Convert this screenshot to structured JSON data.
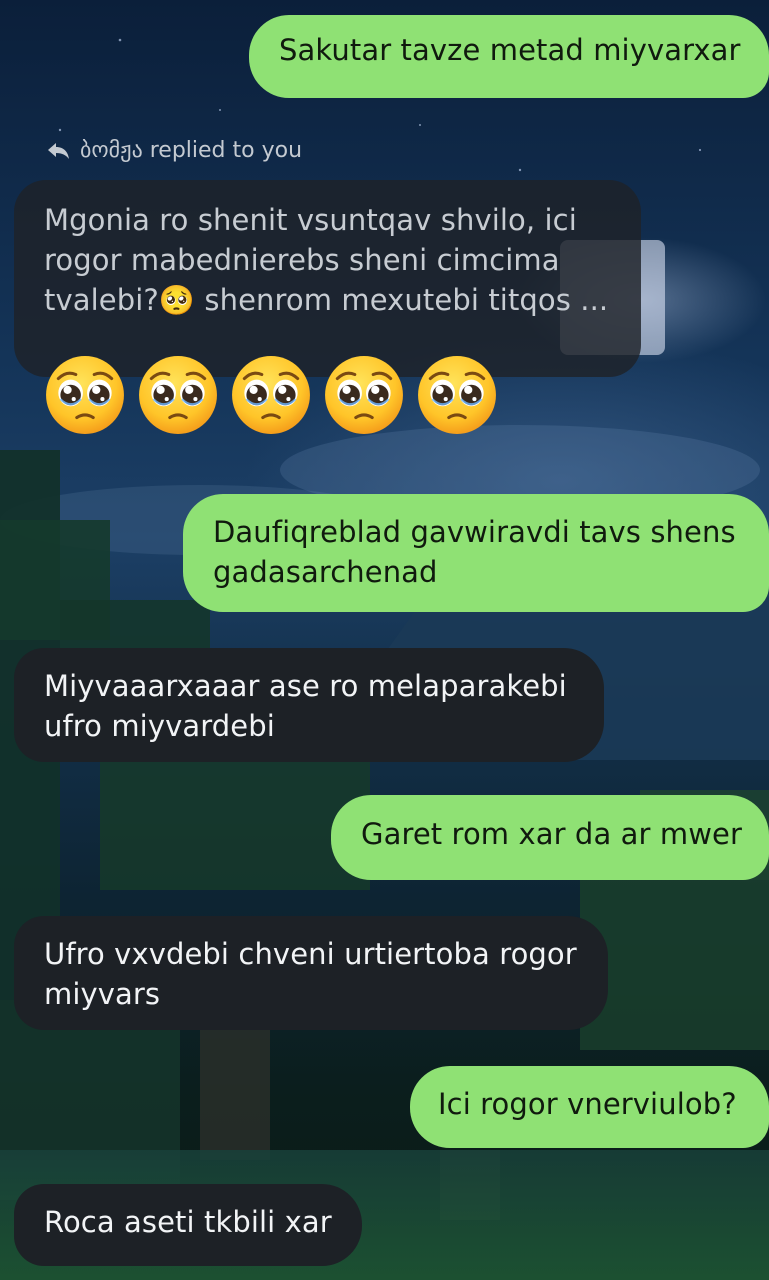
{
  "messages": [
    {
      "text": "Sakutar tavze metad miyvarxar"
    },
    {
      "text": "Daufiqreblad gavwiravdi tavs shens gadasarchenad"
    },
    {
      "text": "Miyvaaarxaaar ase ro melaparakebi ufro miyvardebi"
    },
    {
      "text": "Garet rom xar da ar mwer"
    },
    {
      "text": "Ufro vxvdebi chveni urtiertoba rogor miyvars"
    },
    {
      "text": "Ici rogor vnerviulob?"
    },
    {
      "text": "Roca aseti tkbili xar"
    }
  ],
  "reply": {
    "header": "ბომჟა replied to you",
    "header_icon": "reply-arrow-icon",
    "quoted_text": "Mgonia ro shenit vsuntqav shvilo, ici rogor mabednierebs sheni cimcima tvalebi?🥺 shenrom mexutebi titqos ...",
    "emoji_message": "🥺🥺🥺🥺🥺",
    "emoji_icon": "pleading-face-emoji"
  },
  "colors": {
    "outgoing_bubble": "#8fe174",
    "incoming_bubble": "#1d2126",
    "background_sky": "#143458"
  }
}
